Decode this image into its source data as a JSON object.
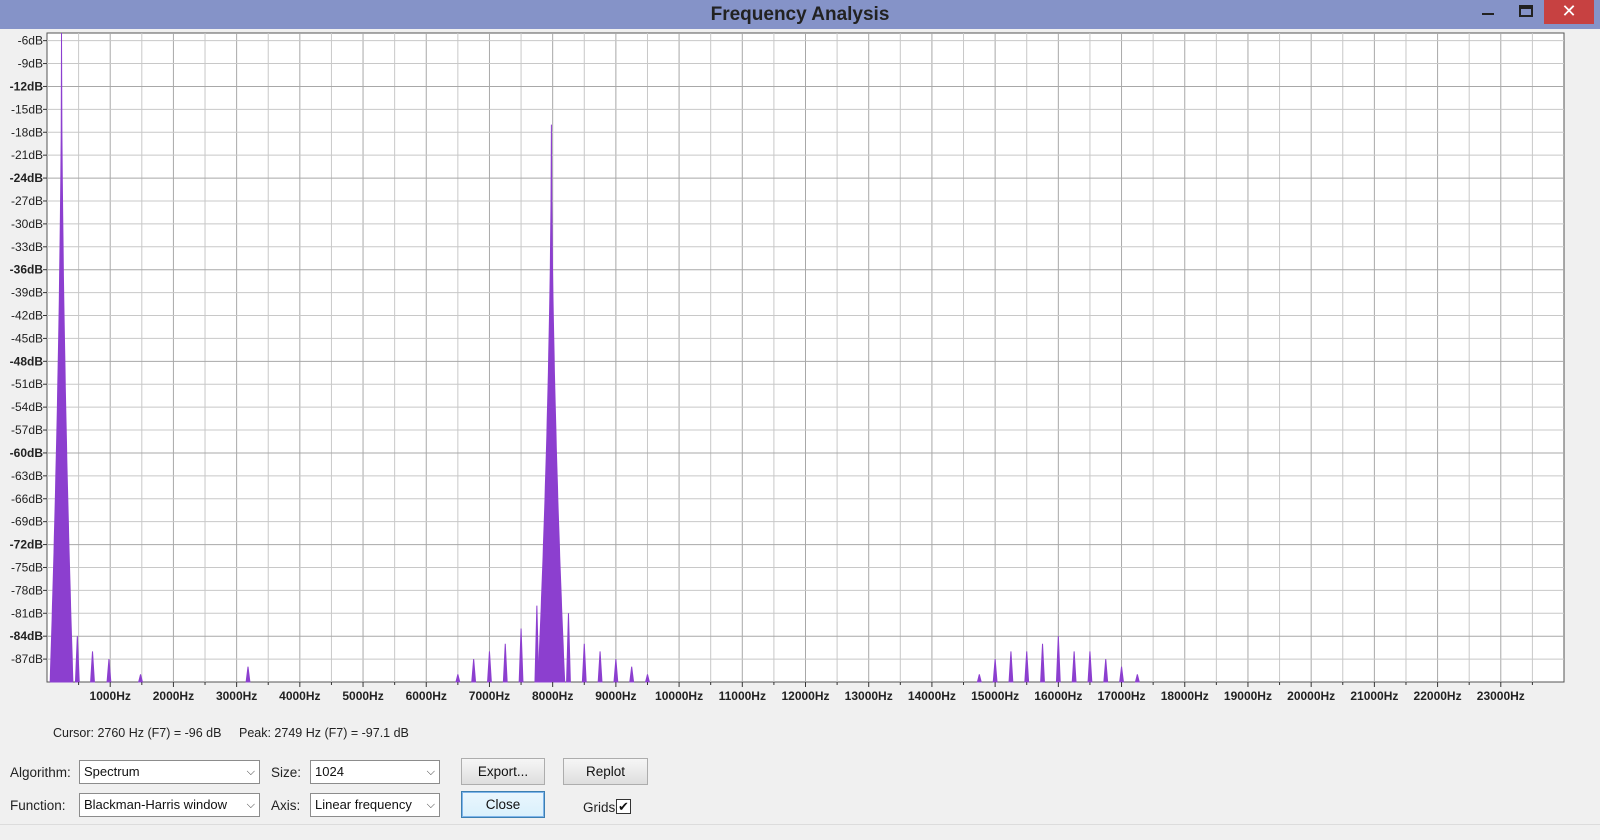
{
  "window": {
    "title": "Frequency Analysis",
    "controls": {
      "minimize": "minimize-icon",
      "maximize": "maximize-icon",
      "close": "✕"
    }
  },
  "status": {
    "cursor": "Cursor: 2760 Hz (F7) = -96 dB",
    "peak": "Peak: 2749 Hz (F7) = -97.1 dB"
  },
  "controls": {
    "algorithm_label": "Algorithm:",
    "algorithm_value": "Spectrum",
    "size_label": "Size:",
    "size_value": "1024",
    "function_label": "Function:",
    "function_value": "Blackman-Harris window",
    "axis_label": "Axis:",
    "axis_value": "Linear frequency",
    "export_label": "Export...",
    "replot_label": "Replot",
    "close_label": "Close",
    "grids_label": "Grids",
    "grids_checked": true
  },
  "colors": {
    "spectrum": "#8c3fcf",
    "grid": "#c8c8c8",
    "plot_bg": "#ffffff",
    "titlebar": "#8593c8"
  },
  "chart_data": {
    "type": "area",
    "ylim": [
      -90,
      -5
    ],
    "xlim": [
      0,
      24000
    ],
    "yticks": [
      {
        "v": -6,
        "label": "-6dB",
        "bold": false
      },
      {
        "v": -9,
        "label": "-9dB",
        "bold": false
      },
      {
        "v": -12,
        "label": "-12dB",
        "bold": true
      },
      {
        "v": -15,
        "label": "-15dB",
        "bold": false
      },
      {
        "v": -18,
        "label": "-18dB",
        "bold": false
      },
      {
        "v": -21,
        "label": "-21dB",
        "bold": false
      },
      {
        "v": -24,
        "label": "-24dB",
        "bold": true
      },
      {
        "v": -27,
        "label": "-27dB",
        "bold": false
      },
      {
        "v": -30,
        "label": "-30dB",
        "bold": false
      },
      {
        "v": -33,
        "label": "-33dB",
        "bold": false
      },
      {
        "v": -36,
        "label": "-36dB",
        "bold": true
      },
      {
        "v": -39,
        "label": "-39dB",
        "bold": false
      },
      {
        "v": -42,
        "label": "-42dB",
        "bold": false
      },
      {
        "v": -45,
        "label": "-45dB",
        "bold": false
      },
      {
        "v": -48,
        "label": "-48dB",
        "bold": true
      },
      {
        "v": -51,
        "label": "-51dB",
        "bold": false
      },
      {
        "v": -54,
        "label": "-54dB",
        "bold": false
      },
      {
        "v": -57,
        "label": "-57dB",
        "bold": false
      },
      {
        "v": -60,
        "label": "-60dB",
        "bold": true
      },
      {
        "v": -63,
        "label": "-63dB",
        "bold": false
      },
      {
        "v": -66,
        "label": "-66dB",
        "bold": false
      },
      {
        "v": -69,
        "label": "-69dB",
        "bold": false
      },
      {
        "v": -72,
        "label": "-72dB",
        "bold": true
      },
      {
        "v": -75,
        "label": "-75dB",
        "bold": false
      },
      {
        "v": -78,
        "label": "-78dB",
        "bold": false
      },
      {
        "v": -81,
        "label": "-81dB",
        "bold": false
      },
      {
        "v": -84,
        "label": "-84dB",
        "bold": true
      },
      {
        "v": -87,
        "label": "-87dB",
        "bold": false
      }
    ],
    "xticks": [
      {
        "v": 1000,
        "label": "1000Hz"
      },
      {
        "v": 2000,
        "label": "2000Hz"
      },
      {
        "v": 3000,
        "label": "3000Hz"
      },
      {
        "v": 4000,
        "label": "4000Hz"
      },
      {
        "v": 5000,
        "label": "5000Hz"
      },
      {
        "v": 6000,
        "label": "6000Hz"
      },
      {
        "v": 7000,
        "label": "7000Hz"
      },
      {
        "v": 8000,
        "label": "8000Hz"
      },
      {
        "v": 9000,
        "label": "9000Hz"
      },
      {
        "v": 10000,
        "label": "10000Hz"
      },
      {
        "v": 11000,
        "label": "11000Hz"
      },
      {
        "v": 12000,
        "label": "12000Hz"
      },
      {
        "v": 13000,
        "label": "13000Hz"
      },
      {
        "v": 14000,
        "label": "14000Hz"
      },
      {
        "v": 15000,
        "label": "15000Hz"
      },
      {
        "v": 16000,
        "label": "16000Hz"
      },
      {
        "v": 17000,
        "label": "17000Hz"
      },
      {
        "v": 18000,
        "label": "18000Hz"
      },
      {
        "v": 19000,
        "label": "19000Hz"
      },
      {
        "v": 20000,
        "label": "20000Hz"
      },
      {
        "v": 21000,
        "label": "21000Hz"
      },
      {
        "v": 22000,
        "label": "22000Hz"
      },
      {
        "v": 23000,
        "label": "23000Hz"
      }
    ],
    "grid": true,
    "peaks": [
      {
        "f": 230,
        "db": -5,
        "width": 180
      },
      {
        "f": 7980,
        "db": -17,
        "width": 210
      }
    ],
    "spurs": [
      {
        "f": 480,
        "db": -84
      },
      {
        "f": 720,
        "db": -86
      },
      {
        "f": 980,
        "db": -87
      },
      {
        "f": 1480,
        "db": -89
      },
      {
        "f": 3180,
        "db": -88
      },
      {
        "f": 6500,
        "db": -89
      },
      {
        "f": 6750,
        "db": -87
      },
      {
        "f": 7000,
        "db": -86
      },
      {
        "f": 7250,
        "db": -85
      },
      {
        "f": 7500,
        "db": -83
      },
      {
        "f": 7750,
        "db": -80
      },
      {
        "f": 8250,
        "db": -81
      },
      {
        "f": 8500,
        "db": -85
      },
      {
        "f": 8750,
        "db": -86
      },
      {
        "f": 9000,
        "db": -87
      },
      {
        "f": 9250,
        "db": -88
      },
      {
        "f": 9500,
        "db": -89
      },
      {
        "f": 14750,
        "db": -89
      },
      {
        "f": 15000,
        "db": -87
      },
      {
        "f": 15250,
        "db": -86
      },
      {
        "f": 15500,
        "db": -86
      },
      {
        "f": 15750,
        "db": -85
      },
      {
        "f": 16000,
        "db": -84
      },
      {
        "f": 16250,
        "db": -86
      },
      {
        "f": 16500,
        "db": -86
      },
      {
        "f": 16750,
        "db": -87
      },
      {
        "f": 17000,
        "db": -88
      },
      {
        "f": 17250,
        "db": -89
      }
    ]
  }
}
